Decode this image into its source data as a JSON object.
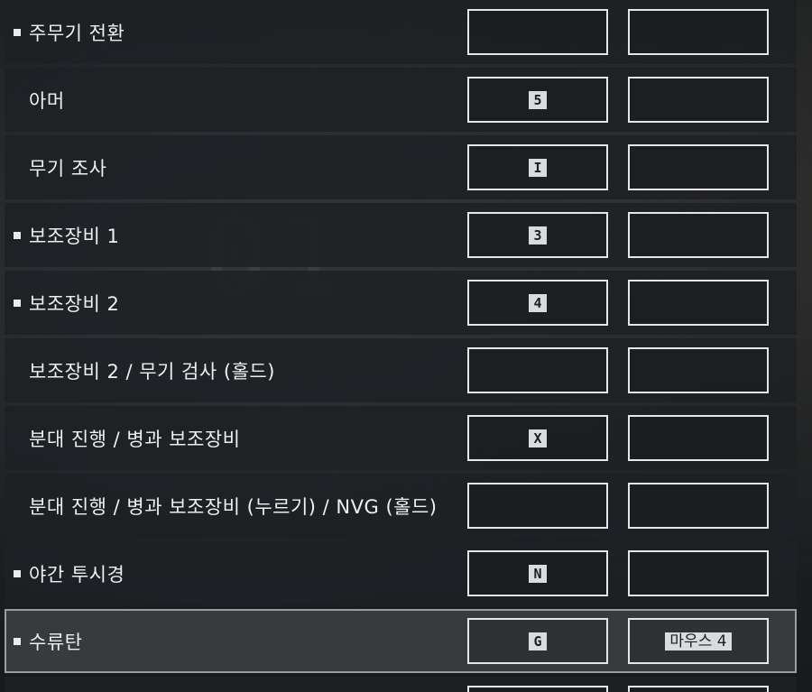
{
  "keybinds": [
    {
      "marker": true,
      "label": "주무기 전환",
      "primary": "",
      "secondary": ""
    },
    {
      "marker": false,
      "label": "아머",
      "primary": "5",
      "secondary": ""
    },
    {
      "marker": false,
      "label": "무기 조사",
      "primary": "I",
      "secondary": ""
    },
    {
      "marker": true,
      "label": "보조장비 1",
      "primary": "3",
      "secondary": ""
    },
    {
      "marker": true,
      "label": "보조장비 2",
      "primary": "4",
      "secondary": ""
    },
    {
      "marker": false,
      "label": "보조장비 2 / 무기 검사 (홀드)",
      "primary": "",
      "secondary": ""
    },
    {
      "marker": false,
      "label": "분대 진행 / 병과 보조장비",
      "primary": "X",
      "secondary": ""
    },
    {
      "marker": false,
      "label": "분대 진행 / 병과 보조장비 (누르기) / NVG (홀드)",
      "primary": "",
      "secondary": ""
    },
    {
      "marker": true,
      "label": "야간 투시경",
      "primary": "N",
      "secondary": ""
    },
    {
      "marker": true,
      "label": "수류탄",
      "primary": "G",
      "secondary": "마우스 4",
      "selected": true
    }
  ]
}
